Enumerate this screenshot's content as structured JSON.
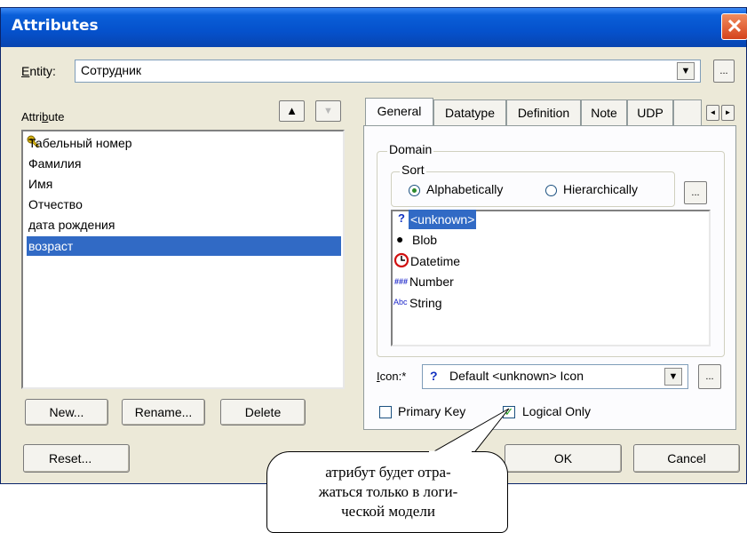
{
  "window": {
    "title": "Attributes",
    "close_glyph": "✕"
  },
  "entity": {
    "label": "Entity:",
    "value": "Сотрудник",
    "browse": "..."
  },
  "attribute_list": {
    "label": "Attribute",
    "items": [
      {
        "text": "Табельный номер",
        "is_key": true
      },
      {
        "text": "Фамилия"
      },
      {
        "text": "Имя"
      },
      {
        "text": "Отчество"
      },
      {
        "text": "дата рождения"
      },
      {
        "text": "возраст",
        "selected": true
      }
    ]
  },
  "buttons": {
    "new": "New...",
    "rename": "Rename...",
    "delete": "Delete",
    "reset": "Reset...",
    "ok": "OK",
    "cancel": "Cancel"
  },
  "tabs": [
    "General",
    "Datatype",
    "Definition",
    "Note",
    "UDP",
    " "
  ],
  "general": {
    "domain_label": "Domain",
    "sort_label": "Sort",
    "sort_options": [
      "Alphabetically",
      "Hierarchically"
    ],
    "sort_selected": "Alphabetically",
    "domain_browse": "...",
    "datatypes": [
      {
        "icon": "?",
        "text": "<unknown>",
        "selected": true
      },
      {
        "icon": "●",
        "text": "Blob"
      },
      {
        "icon": "◷",
        "text": "Datetime"
      },
      {
        "icon": "###",
        "text": "Number"
      },
      {
        "icon": "Abc",
        "text": "String"
      }
    ],
    "icon_label": "Icon:*",
    "icon_value": "Default <unknown> Icon",
    "icon_glyph": "?",
    "icon_browse": "...",
    "primary_key": {
      "label": "Primary Key",
      "checked": false
    },
    "logical_only": {
      "label": "Logical Only",
      "checked": true
    }
  },
  "callout": {
    "line1": "атрибут будет отра-",
    "line2": "жаться только в логи-",
    "line3": "ческой модели"
  },
  "colors": {
    "title_bar": "#0551cc",
    "selection": "#316ac5",
    "dialog_bg": "#ece9d8",
    "close_button": "#d5431c"
  }
}
